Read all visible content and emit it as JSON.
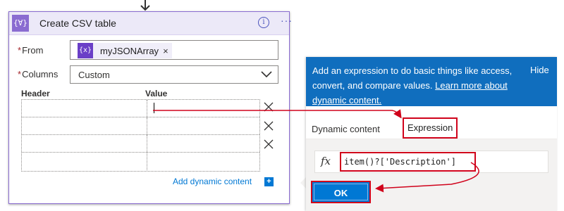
{
  "card": {
    "title": "Create CSV table",
    "icon_glyph": "{∀}",
    "info_glyph": "i",
    "more_glyph": "···"
  },
  "from_field": {
    "label": "From",
    "required_mark": "*",
    "token_icon_glyph": "{x}",
    "token_label": "myJSONArray",
    "token_remove": "×"
  },
  "columns_field": {
    "label": "Columns",
    "required_mark": "*",
    "value": "Custom"
  },
  "table": {
    "headers": [
      "Header",
      "Value"
    ],
    "rows": [
      {
        "header": "",
        "value": ""
      },
      {
        "header": "",
        "value": ""
      },
      {
        "header": "",
        "value": ""
      },
      {
        "header": "",
        "value": ""
      }
    ]
  },
  "add_dynamic": {
    "label": "Add dynamic content",
    "plus_glyph": "+"
  },
  "pane": {
    "banner_text": "Add an expression to do basic things like access, convert, and compare values.",
    "learn_link": "Learn more about dynamic content.",
    "hide": "Hide",
    "tabs": [
      "Dynamic content",
      "Expression"
    ],
    "active_tab": "Expression",
    "fx_glyph": "fx",
    "expression_value": "item()?['Description']",
    "ok_label": "OK"
  },
  "colors": {
    "brand_purple": "#8a6cd1",
    "banner_blue": "#106ebe",
    "accent_blue": "#0078d4",
    "highlight_red": "#d0021b"
  }
}
